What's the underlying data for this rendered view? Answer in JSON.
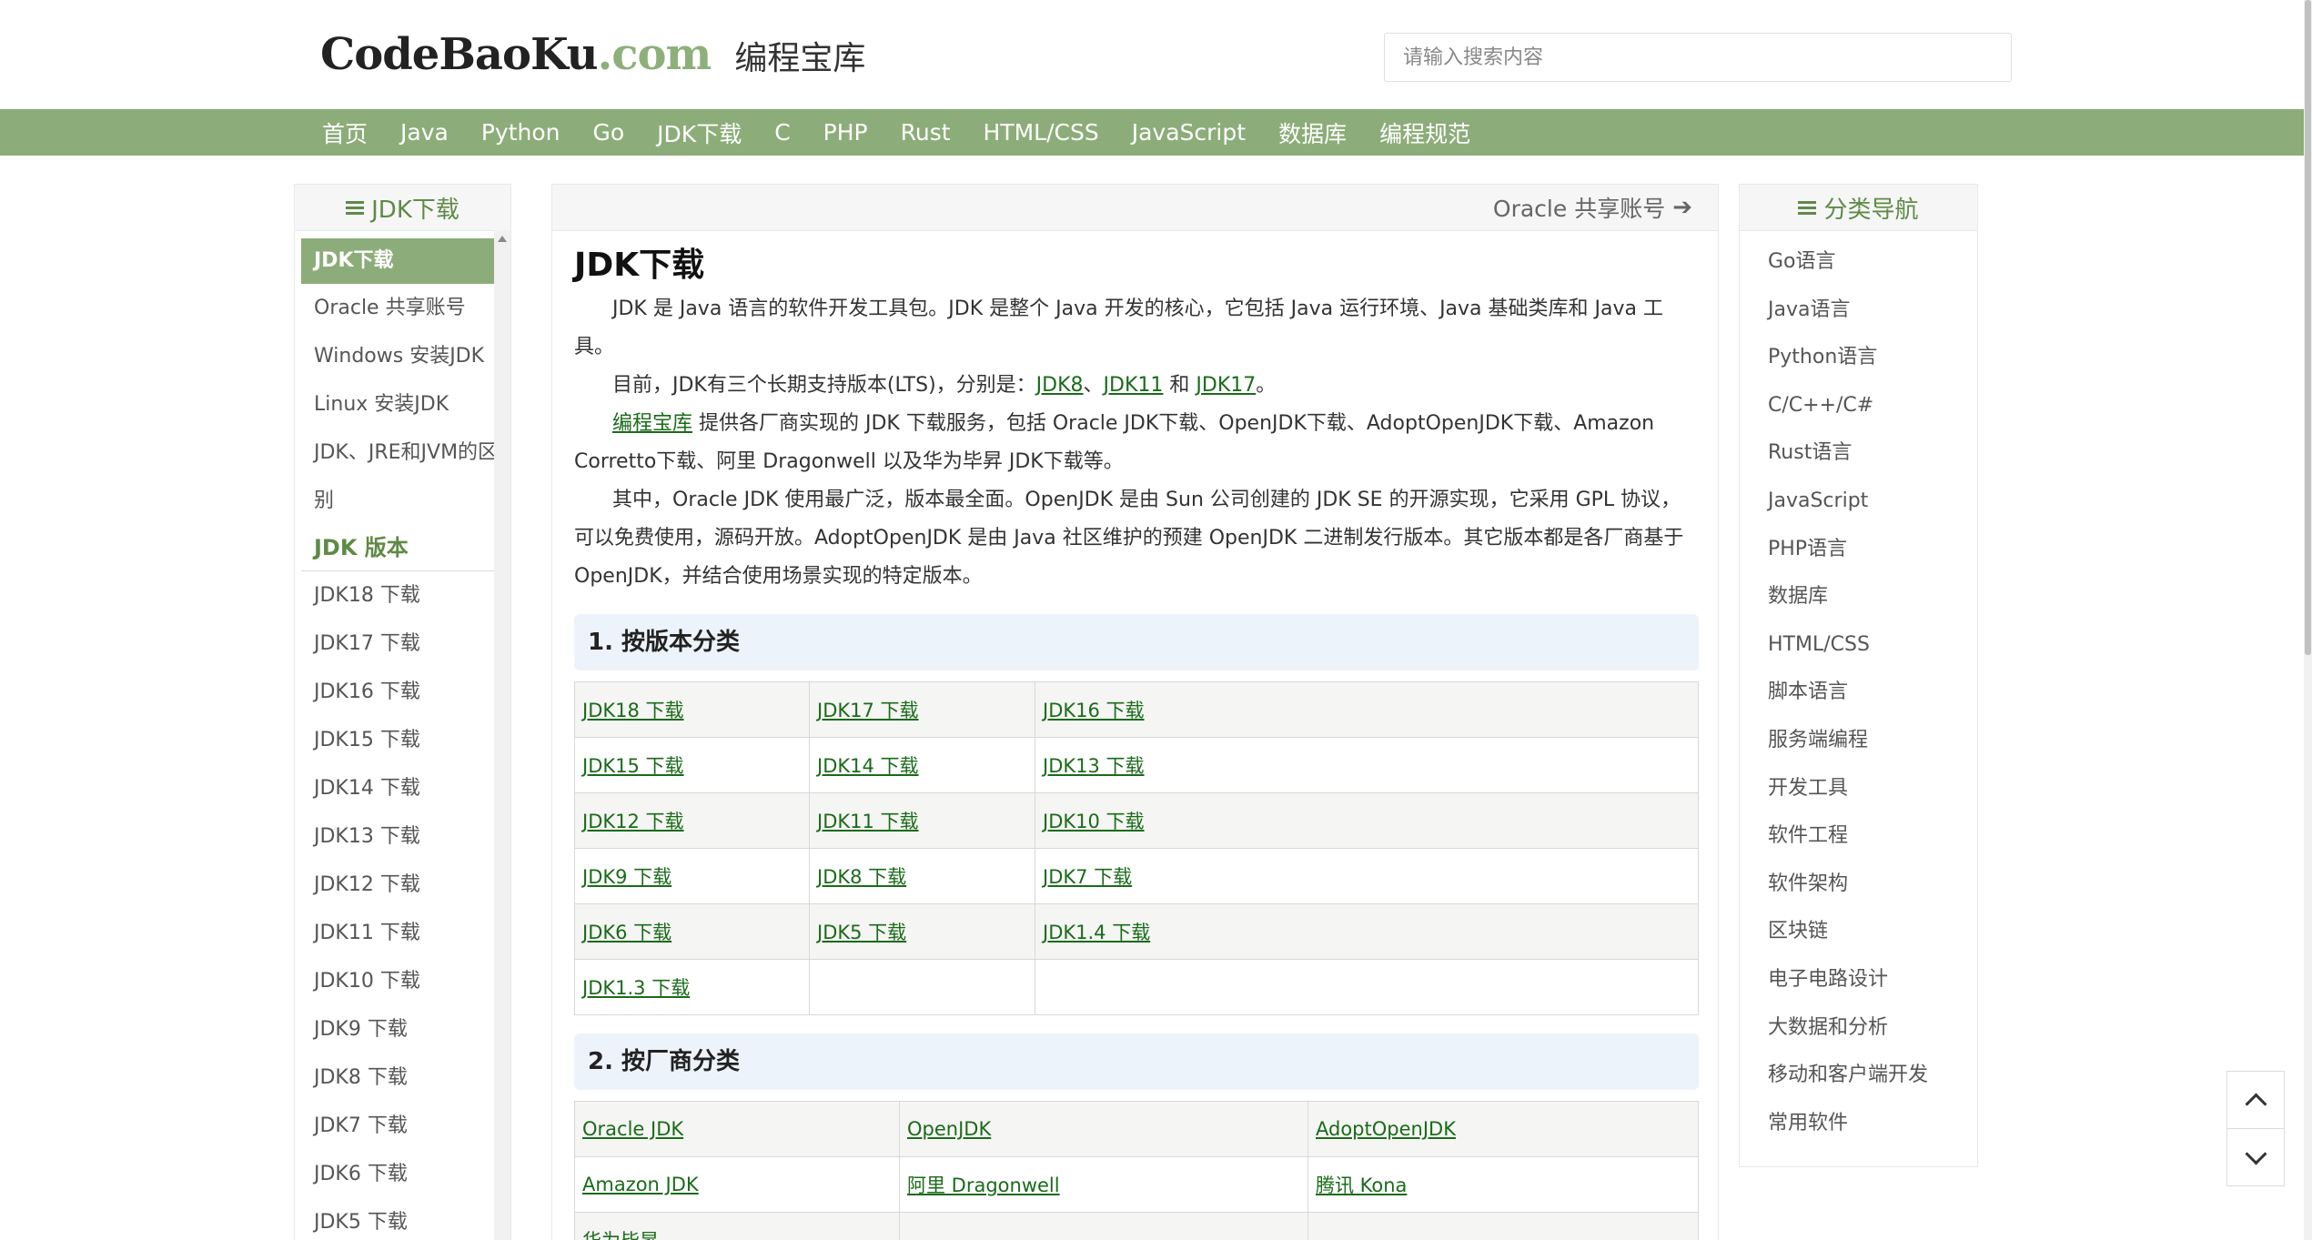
{
  "header": {
    "logo_brand": "CodeBaoKu",
    "logo_tld": ".com",
    "logo_cn": "编程宝库",
    "search_placeholder": "请输入搜索内容"
  },
  "nav": [
    "首页",
    "Java",
    "Python",
    "Go",
    "JDK下载",
    "C",
    "PHP",
    "Rust",
    "HTML/CSS",
    "JavaScript",
    "数据库",
    "编程规范"
  ],
  "left_sidebar": {
    "title": "JDK下载",
    "items": [
      "JDK下载",
      "Oracle 共享账号",
      "Windows 安装JDK",
      "Linux 安装JDK",
      "JDK、JRE和JVM的区别"
    ],
    "section": "JDK 版本",
    "versions": [
      "JDK18 下载",
      "JDK17 下载",
      "JDK16 下载",
      "JDK15 下载",
      "JDK14 下载",
      "JDK13 下载",
      "JDK12 下载",
      "JDK11 下载",
      "JDK10 下载",
      "JDK9 下载",
      "JDK8 下载",
      "JDK7 下载",
      "JDK6 下载",
      "JDK5 下载"
    ]
  },
  "main": {
    "topbar_link": "Oracle 共享账号",
    "title": "JDK下载",
    "p1": "JDK 是 Java 语言的软件开发工具包。JDK 是整个 Java 开发的核心，它包括 Java 运行环境、Java 基础类库和 Java 工具。",
    "p2_prefix": "目前，JDK有三个长期支持版本(LTS)，分别是：",
    "p2_link1": "JDK8",
    "p2_sep1": "、",
    "p2_link2": "JDK11",
    "p2_sep2": " 和 ",
    "p2_link3": "JDK17",
    "p2_end": "。",
    "p3_link": "编程宝库",
    "p3_text": " 提供各厂商实现的 JDK 下载服务，包括 Oracle JDK下载、OpenJDK下载、AdoptOpenJDK下载、Amazon Corretto下载、阿里 Dragonwell 以及华为毕昇 JDK下载等。",
    "p4": "其中，Oracle JDK 使用最广泛，版本最全面。OpenJDK 是由 Sun 公司创建的 JDK SE 的开源实现，它采用 GPL 协议，可以免费使用，源码开放。AdoptOpenJDK 是由 Java 社区维护的预建 OpenJDK 二进制发行版本。其它版本都是各厂商基于 OpenJDK，并结合使用场景实现的特定版本。",
    "section1": "1. 按版本分类",
    "version_table": [
      [
        "JDK18 下载",
        "JDK17 下载",
        "JDK16 下载"
      ],
      [
        "JDK15 下载",
        "JDK14 下载",
        "JDK13 下载"
      ],
      [
        "JDK12 下载",
        "JDK11 下载",
        "JDK10 下载"
      ],
      [
        "JDK9 下载",
        "JDK8 下载",
        "JDK7 下载"
      ],
      [
        "JDK6 下载",
        "JDK5 下载",
        "JDK1.4 下载"
      ],
      [
        "JDK1.3 下载",
        "",
        ""
      ]
    ],
    "section2": "2. 按厂商分类",
    "vendor_table": [
      [
        "Oracle JDK",
        "OpenJDK",
        "AdoptOpenJDK"
      ],
      [
        "Amazon JDK",
        "阿里 Dragonwell",
        "腾讯 Kona"
      ],
      [
        "华为毕昇",
        "",
        ""
      ]
    ]
  },
  "right_sidebar": {
    "title": "分类导航",
    "items": [
      "Go语言",
      "Java语言",
      "Python语言",
      "C/C++/C#",
      "Rust语言",
      "JavaScript",
      "PHP语言",
      "数据库",
      "HTML/CSS",
      "脚本语言",
      "服务端编程",
      "开发工具",
      "软件工程",
      "软件架构",
      "区块链",
      "电子电路设计",
      "大数据和分析",
      "移动和客户端开发",
      "常用软件"
    ]
  }
}
